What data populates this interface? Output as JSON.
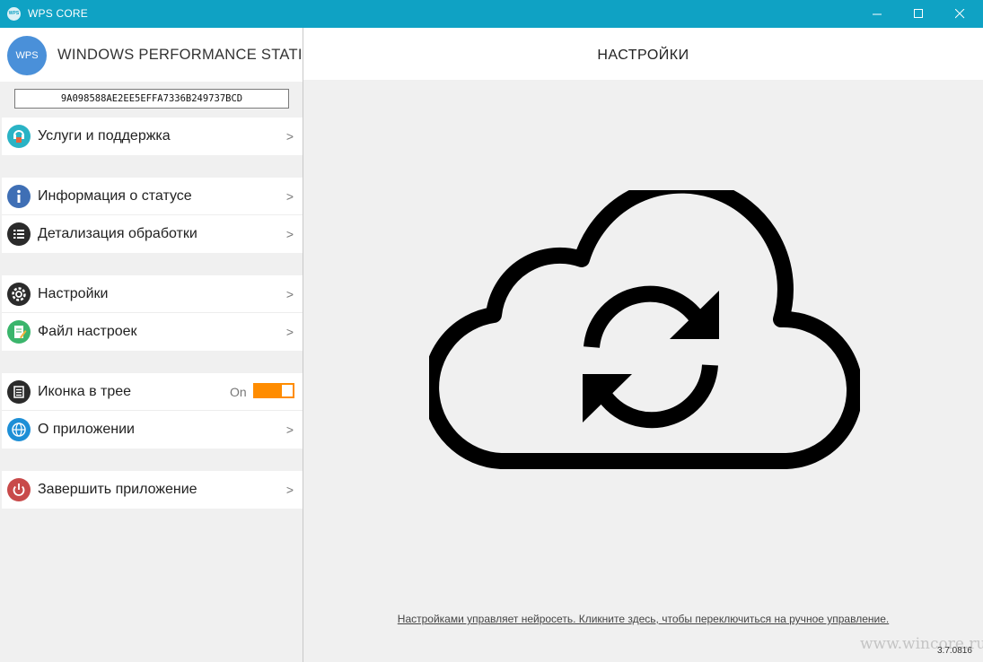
{
  "window": {
    "title": "WPS CORE",
    "app_icon_text": "WPS",
    "titlebar_color": "#0fa2c4"
  },
  "sidebar": {
    "brand": {
      "logo_text": "WPS",
      "name": "WINDOWS PERFORMANCE STATION"
    },
    "license_key": "9A098588AE2EE5EFFA7336B249737BCD",
    "items": [
      {
        "label": "Услуги и поддержка",
        "icon": "support-icon",
        "chevron": ">"
      },
      {
        "label": "Информация о статусе",
        "icon": "info-icon",
        "chevron": ">"
      },
      {
        "label": "Детализация обработки",
        "icon": "list-icon",
        "chevron": ">"
      },
      {
        "label": "Настройки",
        "icon": "gear-icon",
        "chevron": ">"
      },
      {
        "label": "Файл настроек",
        "icon": "settings-file-icon",
        "chevron": ">"
      },
      {
        "label": "Иконка в трее",
        "icon": "tray-icon",
        "toggle_text": "On",
        "toggle_on": true,
        "toggle_color": "#ff8c00"
      },
      {
        "label": "О приложении",
        "icon": "globe-icon",
        "chevron": ">"
      },
      {
        "label": "Завершить приложение",
        "icon": "power-icon",
        "chevron": ">"
      }
    ]
  },
  "main": {
    "title": "НАСТРОЙКИ",
    "illustration": "cloud-sync-icon",
    "footer_link": "Настройками управляет нейросеть. Кликните здесь, чтобы переключиться на ручное управление.",
    "version": "3.7.0816"
  },
  "watermark": "www.wincore.ru"
}
